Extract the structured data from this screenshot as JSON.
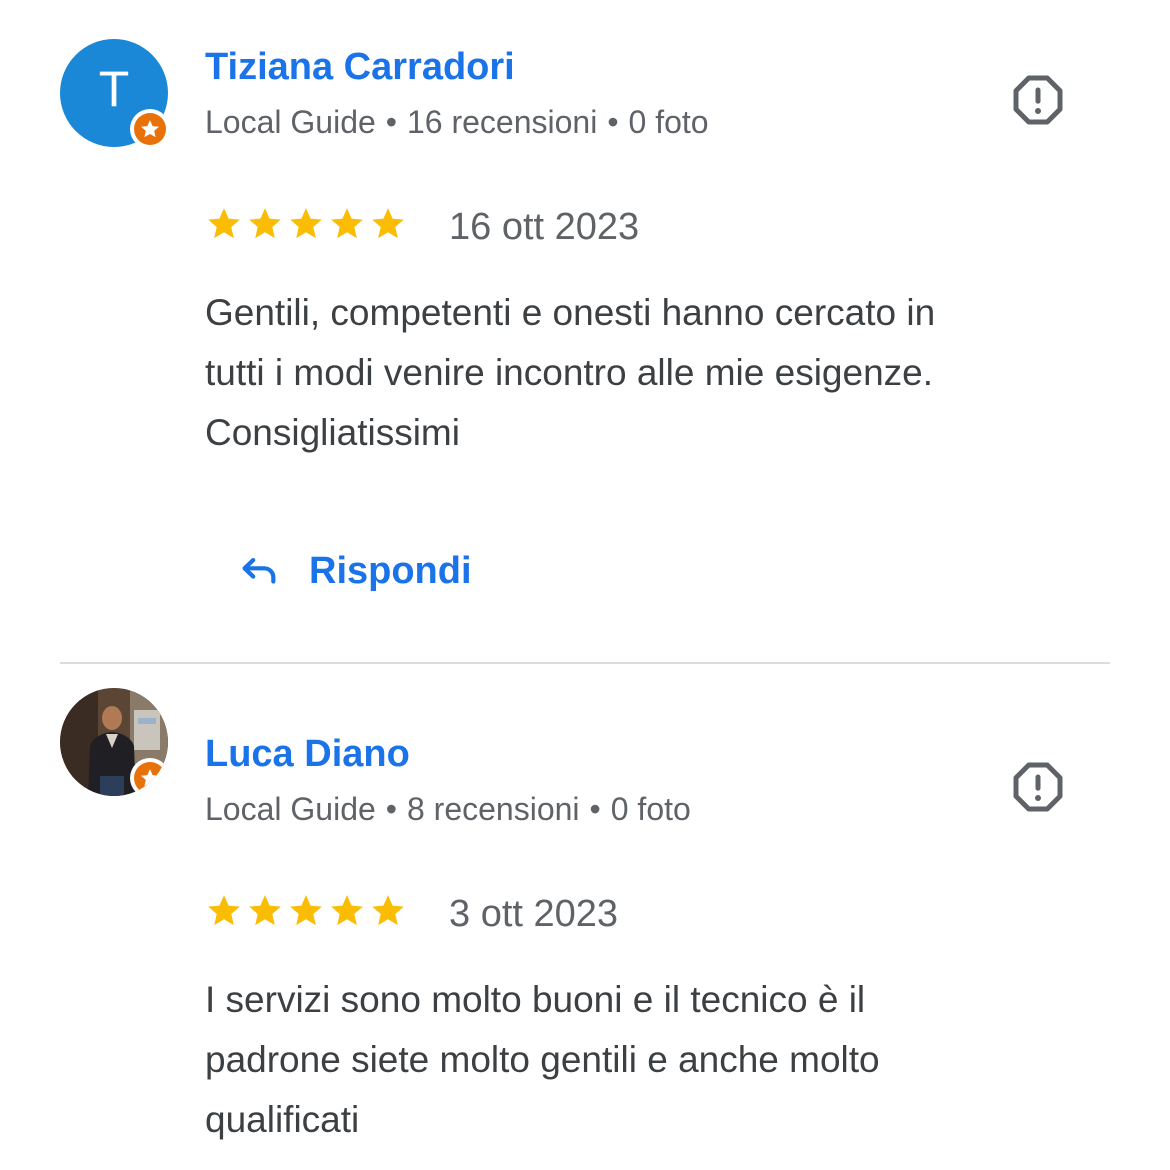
{
  "colors": {
    "accent": "#1a73e8",
    "star": "#fbbc04",
    "avatar_blue": "#1a88d6",
    "badge_orange": "#e8710a",
    "text": "#3c4043",
    "secondary_text": "#5f6368",
    "divider": "#dadce0"
  },
  "reviews": [
    {
      "avatar_letter": "T",
      "author": "Tiziana Carradori",
      "badge": "Local Guide",
      "reviews_count": "16 recensioni",
      "photos_count": "0 foto",
      "rating": 5,
      "date": "16 ott 2023",
      "text_lines": [
        "Gentili, competenti e onesti hanno cercato in",
        "tutti i modi venire incontro alle mie esigenze.",
        "Consigliatissimi"
      ],
      "reply_label": "Rispondi"
    },
    {
      "avatar_letter": "",
      "author": "Luca Diano",
      "badge": "Local Guide",
      "reviews_count": "8 recensioni",
      "photos_count": "0 foto",
      "rating": 5,
      "date": "3 ott 2023",
      "text_lines": [
        "I servizi sono molto buoni e il tecnico è il",
        "padrone siete molto gentili e anche molto",
        "qualificati"
      ]
    }
  ],
  "icons": {
    "report": "report-flag-icon",
    "reply": "reply-arrow-icon",
    "star": "star-icon",
    "local_guide": "local-guide-star-icon"
  },
  "separator": "•"
}
